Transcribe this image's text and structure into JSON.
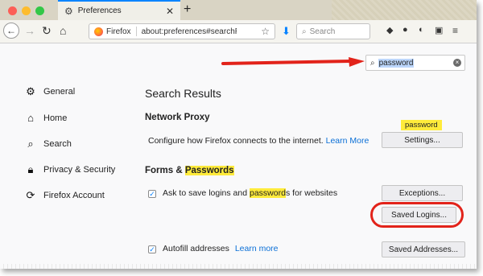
{
  "tab": {
    "title": "Preferences"
  },
  "toolbar": {
    "brand": "Firefox",
    "url": "about:preferences#searchRes",
    "search_placeholder": "Search"
  },
  "find": {
    "value": "password"
  },
  "sidebar": {
    "items": [
      {
        "label": "General"
      },
      {
        "label": "Home"
      },
      {
        "label": "Search"
      },
      {
        "label": "Privacy & Security"
      },
      {
        "label": "Firefox Account"
      }
    ]
  },
  "main": {
    "heading": "Search Results",
    "network_proxy": {
      "title": "Network Proxy",
      "description": "Configure how Firefox connects to the internet.",
      "learn_more": "Learn More",
      "settings_button": "Settings...",
      "tooltip": "password"
    },
    "forms": {
      "title_prefix": "Forms & ",
      "title_highlight": "Passwords",
      "ask_prefix": "Ask to save logins and ",
      "ask_highlight": "password",
      "ask_suffix": "s for websites",
      "exceptions_button": "Exceptions...",
      "saved_logins_button": "Saved Logins...",
      "autofill_label": "Autofill addresses",
      "autofill_learn_more": "Learn more",
      "saved_addresses_button": "Saved Addresses..."
    }
  },
  "colors": {
    "accent": "#0a84ff",
    "highlight": "#ffeb3b",
    "annotation": "#e2231a"
  }
}
